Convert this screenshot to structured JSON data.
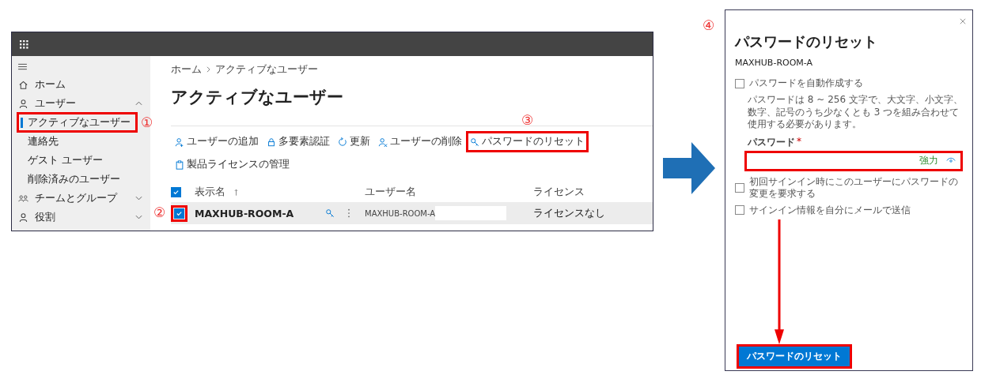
{
  "main_window": {
    "sidebar": {
      "items": [
        {
          "kind": "link",
          "label": "ホーム",
          "selected": false
        },
        {
          "kind": "group",
          "label": "ユーザー",
          "expanded": true,
          "children": [
            {
              "label": "アクティブなユーザー",
              "selected": true,
              "highlighted": true,
              "marker": "①"
            },
            {
              "label": "連絡先",
              "selected": false,
              "highlighted": false
            },
            {
              "label": "ゲスト ユーザー",
              "selected": false,
              "highlighted": false
            },
            {
              "label": "削除済みのユーザー",
              "selected": false,
              "highlighted": false
            }
          ]
        },
        {
          "kind": "group",
          "label": "チームとグループ",
          "expanded": false
        },
        {
          "kind": "group",
          "label": "役割",
          "expanded": false
        }
      ]
    },
    "breadcrumb": [
      "ホーム",
      "アクティブなユーザー"
    ],
    "page_title": "アクティブなユーザー",
    "toolbar": [
      {
        "label": "ユーザーの追加",
        "highlighted": false
      },
      {
        "label": "多要素認証",
        "highlighted": false
      },
      {
        "label": "更新",
        "highlighted": false
      },
      {
        "label": "ユーザーの削除",
        "highlighted": false
      },
      {
        "label": "パスワードのリセット",
        "highlighted": true,
        "marker": "③"
      },
      {
        "label": "製品ライセンスの管理",
        "highlighted": false
      }
    ],
    "table": {
      "select_all": {
        "checked": true
      },
      "columns": [
        {
          "label": "表示名",
          "sorted": true
        },
        {
          "label": "ユーザー名",
          "sorted": false
        },
        {
          "label": "ライセンス",
          "sorted": false
        }
      ],
      "rows": [
        {
          "selected": true,
          "checked": true,
          "highlighted": true,
          "marker": "②",
          "display_name": "MAXHUB-ROOM-A",
          "user_name": "MAXHUB-ROOM-A",
          "license": "ライセンスなし"
        }
      ]
    }
  },
  "reset_panel": {
    "marker": "④",
    "title": "パスワードのリセット",
    "user": "MAXHUB-ROOM-A",
    "auto_generate": {
      "label": "パスワードを自動作成する",
      "checked": false
    },
    "description": "パスワードは 8 ~ 256 文字で、大文字、小文字、数字、記号のうち少なくとも 3 つを組み合わせて使用する必要があります。",
    "password": {
      "label": "パスワード",
      "required_mark": "*",
      "strength": "強力",
      "highlighted": true
    },
    "options": [
      {
        "label": "初回サインイン時にこのユーザーにパスワードの変更を要求する",
        "checked": false
      },
      {
        "label": "サインイン情報を自分にメールで送信",
        "checked": false
      }
    ],
    "button": {
      "label": "パスワードのリセット",
      "highlighted": true
    }
  }
}
